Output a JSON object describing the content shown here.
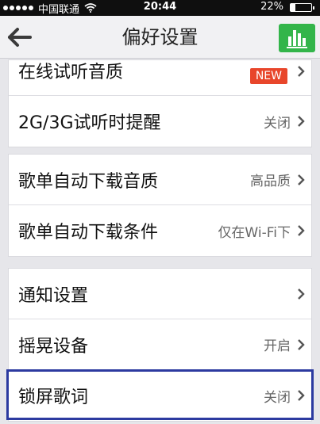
{
  "status": {
    "carrier": "中国联通",
    "time": "20:44",
    "battery": "22%",
    "battery_level": 0.22
  },
  "header": {
    "title": "偏好设置",
    "back_icon": "back-arrow-icon",
    "right_icon": "bar-chart-icon",
    "accent_color": "#33b54a"
  },
  "groups": [
    {
      "rows": [
        {
          "label": "在线试听音质",
          "badge": "NEW"
        },
        {
          "label": "2G/3G试听时提醒",
          "value": "关闭"
        }
      ]
    },
    {
      "rows": [
        {
          "label": "歌单自动下载音质",
          "value": "高品质"
        },
        {
          "label": "歌单自动下载条件",
          "value": "仅在Wi-Fi下"
        }
      ]
    },
    {
      "rows": [
        {
          "label": "通知设置",
          "value": ""
        },
        {
          "label": "摇晃设备",
          "value": "开启"
        },
        {
          "label": "锁屏歌词",
          "value": "关闭"
        }
      ]
    }
  ],
  "highlight_color": "#2c3aa0"
}
